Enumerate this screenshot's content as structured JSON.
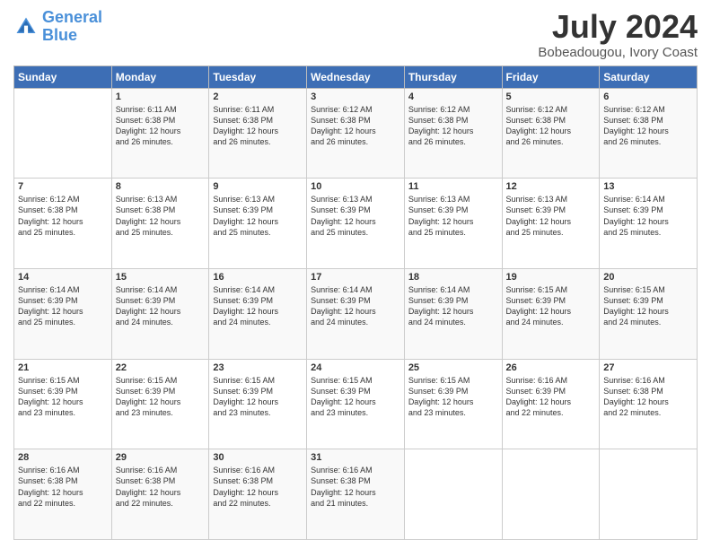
{
  "header": {
    "logo_line1": "General",
    "logo_line2": "Blue",
    "month_year": "July 2024",
    "location": "Bobeadougou, Ivory Coast"
  },
  "days_of_week": [
    "Sunday",
    "Monday",
    "Tuesday",
    "Wednesday",
    "Thursday",
    "Friday",
    "Saturday"
  ],
  "weeks": [
    [
      {
        "day": "",
        "info": ""
      },
      {
        "day": "1",
        "info": "Sunrise: 6:11 AM\nSunset: 6:38 PM\nDaylight: 12 hours\nand 26 minutes."
      },
      {
        "day": "2",
        "info": "Sunrise: 6:11 AM\nSunset: 6:38 PM\nDaylight: 12 hours\nand 26 minutes."
      },
      {
        "day": "3",
        "info": "Sunrise: 6:12 AM\nSunset: 6:38 PM\nDaylight: 12 hours\nand 26 minutes."
      },
      {
        "day": "4",
        "info": "Sunrise: 6:12 AM\nSunset: 6:38 PM\nDaylight: 12 hours\nand 26 minutes."
      },
      {
        "day": "5",
        "info": "Sunrise: 6:12 AM\nSunset: 6:38 PM\nDaylight: 12 hours\nand 26 minutes."
      },
      {
        "day": "6",
        "info": "Sunrise: 6:12 AM\nSunset: 6:38 PM\nDaylight: 12 hours\nand 26 minutes."
      }
    ],
    [
      {
        "day": "7",
        "info": "Sunrise: 6:12 AM\nSunset: 6:38 PM\nDaylight: 12 hours\nand 25 minutes."
      },
      {
        "day": "8",
        "info": "Sunrise: 6:13 AM\nSunset: 6:38 PM\nDaylight: 12 hours\nand 25 minutes."
      },
      {
        "day": "9",
        "info": "Sunrise: 6:13 AM\nSunset: 6:39 PM\nDaylight: 12 hours\nand 25 minutes."
      },
      {
        "day": "10",
        "info": "Sunrise: 6:13 AM\nSunset: 6:39 PM\nDaylight: 12 hours\nand 25 minutes."
      },
      {
        "day": "11",
        "info": "Sunrise: 6:13 AM\nSunset: 6:39 PM\nDaylight: 12 hours\nand 25 minutes."
      },
      {
        "day": "12",
        "info": "Sunrise: 6:13 AM\nSunset: 6:39 PM\nDaylight: 12 hours\nand 25 minutes."
      },
      {
        "day": "13",
        "info": "Sunrise: 6:14 AM\nSunset: 6:39 PM\nDaylight: 12 hours\nand 25 minutes."
      }
    ],
    [
      {
        "day": "14",
        "info": "Sunrise: 6:14 AM\nSunset: 6:39 PM\nDaylight: 12 hours\nand 25 minutes."
      },
      {
        "day": "15",
        "info": "Sunrise: 6:14 AM\nSunset: 6:39 PM\nDaylight: 12 hours\nand 24 minutes."
      },
      {
        "day": "16",
        "info": "Sunrise: 6:14 AM\nSunset: 6:39 PM\nDaylight: 12 hours\nand 24 minutes."
      },
      {
        "day": "17",
        "info": "Sunrise: 6:14 AM\nSunset: 6:39 PM\nDaylight: 12 hours\nand 24 minutes."
      },
      {
        "day": "18",
        "info": "Sunrise: 6:14 AM\nSunset: 6:39 PM\nDaylight: 12 hours\nand 24 minutes."
      },
      {
        "day": "19",
        "info": "Sunrise: 6:15 AM\nSunset: 6:39 PM\nDaylight: 12 hours\nand 24 minutes."
      },
      {
        "day": "20",
        "info": "Sunrise: 6:15 AM\nSunset: 6:39 PM\nDaylight: 12 hours\nand 24 minutes."
      }
    ],
    [
      {
        "day": "21",
        "info": "Sunrise: 6:15 AM\nSunset: 6:39 PM\nDaylight: 12 hours\nand 23 minutes."
      },
      {
        "day": "22",
        "info": "Sunrise: 6:15 AM\nSunset: 6:39 PM\nDaylight: 12 hours\nand 23 minutes."
      },
      {
        "day": "23",
        "info": "Sunrise: 6:15 AM\nSunset: 6:39 PM\nDaylight: 12 hours\nand 23 minutes."
      },
      {
        "day": "24",
        "info": "Sunrise: 6:15 AM\nSunset: 6:39 PM\nDaylight: 12 hours\nand 23 minutes."
      },
      {
        "day": "25",
        "info": "Sunrise: 6:15 AM\nSunset: 6:39 PM\nDaylight: 12 hours\nand 23 minutes."
      },
      {
        "day": "26",
        "info": "Sunrise: 6:16 AM\nSunset: 6:39 PM\nDaylight: 12 hours\nand 22 minutes."
      },
      {
        "day": "27",
        "info": "Sunrise: 6:16 AM\nSunset: 6:38 PM\nDaylight: 12 hours\nand 22 minutes."
      }
    ],
    [
      {
        "day": "28",
        "info": "Sunrise: 6:16 AM\nSunset: 6:38 PM\nDaylight: 12 hours\nand 22 minutes."
      },
      {
        "day": "29",
        "info": "Sunrise: 6:16 AM\nSunset: 6:38 PM\nDaylight: 12 hours\nand 22 minutes."
      },
      {
        "day": "30",
        "info": "Sunrise: 6:16 AM\nSunset: 6:38 PM\nDaylight: 12 hours\nand 22 minutes."
      },
      {
        "day": "31",
        "info": "Sunrise: 6:16 AM\nSunset: 6:38 PM\nDaylight: 12 hours\nand 21 minutes."
      },
      {
        "day": "",
        "info": ""
      },
      {
        "day": "",
        "info": ""
      },
      {
        "day": "",
        "info": ""
      }
    ]
  ]
}
